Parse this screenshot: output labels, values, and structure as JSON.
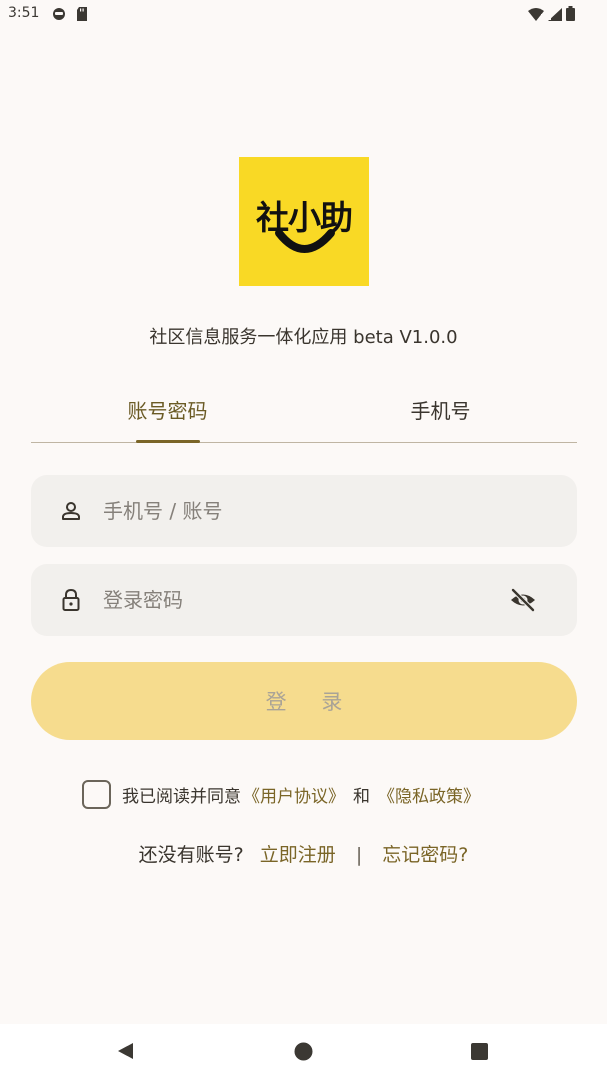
{
  "status_bar": {
    "time": "3:51",
    "icons_left": [
      "emoji-icon",
      "sd-card-icon"
    ],
    "icons_right": [
      "wifi-icon",
      "signal-icon",
      "battery-icon"
    ]
  },
  "logo": {
    "text": "社小助",
    "background": "#f9d925"
  },
  "app": {
    "subtitle": "社区信息服务一体化应用 beta V1.0.0"
  },
  "tabs": [
    {
      "label": "账号密码",
      "active": true
    },
    {
      "label": "手机号",
      "active": false
    }
  ],
  "form": {
    "account_placeholder": "手机号 / 账号",
    "account_value": "",
    "password_placeholder": "登录密码",
    "password_value": "",
    "login_label": "登 录"
  },
  "agreement": {
    "checked": false,
    "prefix": "我已阅读并同意",
    "user_agreement": "《用户协议》",
    "and": "和",
    "privacy_policy": "《隐私政策》"
  },
  "links": {
    "no_account": "还没有账号?",
    "register": "立即注册",
    "divider": "|",
    "forgot_password": "忘记密码?"
  },
  "colors": {
    "accent": "#7a6527",
    "button_bg": "#f6dc8e",
    "field_bg": "#f2f0ed",
    "page_bg": "#fcf9f7"
  }
}
